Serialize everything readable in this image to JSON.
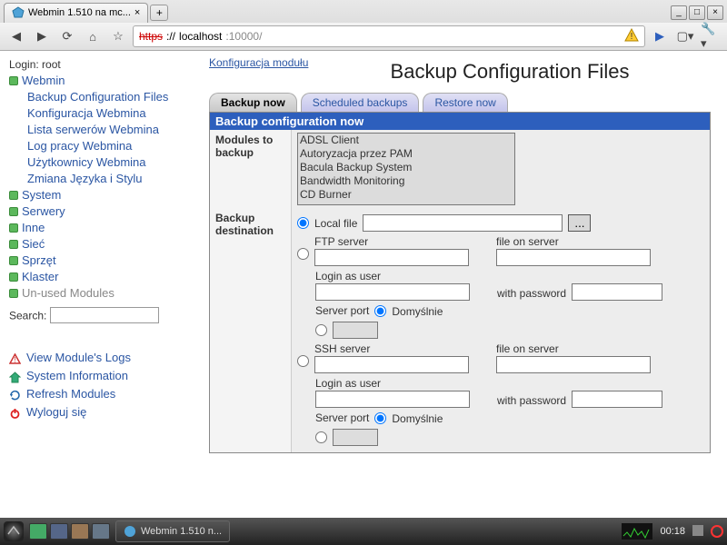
{
  "browser": {
    "tab_title": "Webmin 1.510 na mc...",
    "close_tab": "×",
    "url_scheme": "https",
    "url_sep": "://",
    "url_host": "localhost",
    "url_port": ":10000/",
    "min": "_",
    "max": "□",
    "close": "×",
    "plus": "+"
  },
  "sidebar": {
    "login": "Login: root",
    "cats": [
      {
        "label": "Webmin",
        "expanded": true,
        "items": [
          "Backup Configuration Files",
          "Konfiguracja Webmina",
          "Lista serwerów Webmina",
          "Log pracy Webmina",
          "Użytkownicy Webmina",
          "Zmiana Języka i Stylu"
        ]
      },
      {
        "label": "System"
      },
      {
        "label": "Serwery"
      },
      {
        "label": "Inne"
      },
      {
        "label": "Sieć"
      },
      {
        "label": "Sprzęt"
      },
      {
        "label": "Klaster"
      },
      {
        "label": "Un-used Modules",
        "muted": true
      }
    ],
    "search_label": "Search:",
    "footer": {
      "logs": "View Module's Logs",
      "sysinfo": "System Information",
      "refresh": "Refresh Modules",
      "logout": "Wyloguj się"
    }
  },
  "main": {
    "config_link": "Konfiguracja modułu",
    "title": "Backup Configuration Files",
    "tabs": [
      "Backup now",
      "Scheduled backups",
      "Restore now"
    ],
    "panel_title": "Backup configuration now",
    "labels": {
      "modules": "Modules to backup",
      "dest": "Backup destination",
      "local_file": "Local file",
      "ftp": "FTP server",
      "file_on_server": "file on server",
      "login_as": "Login as user",
      "with_pw": "with password",
      "server_port": "Server port",
      "default": "Domyślnie",
      "ssh": "SSH server"
    },
    "modules": [
      "ADSL Client",
      "Autoryzacja przez PAM",
      "Bacula Backup System",
      "Bandwidth Monitoring",
      "CD Burner"
    ],
    "ellipsis": "..."
  },
  "taskbar": {
    "task": "Webmin 1.510 n...",
    "clock": "00:18"
  }
}
